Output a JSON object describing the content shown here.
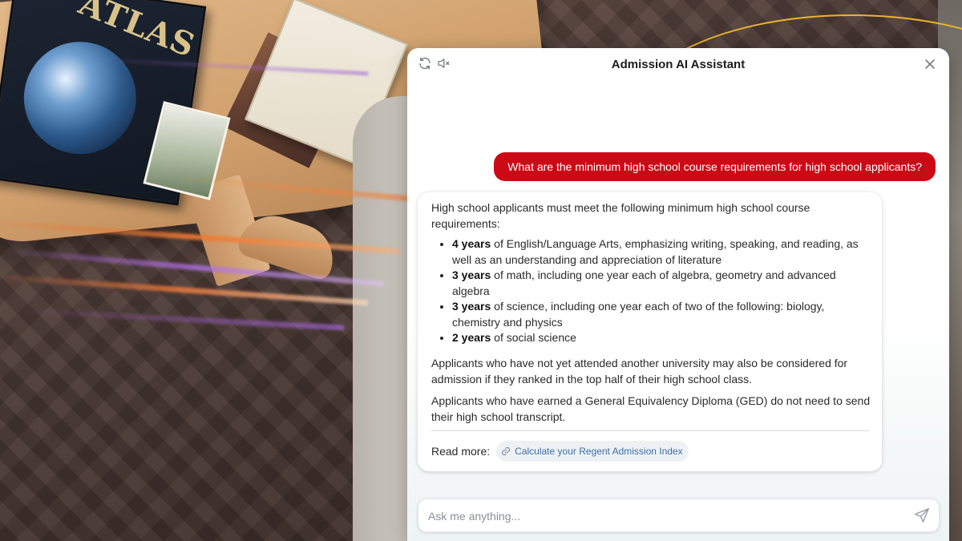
{
  "panel": {
    "title": "Admission AI Assistant",
    "icons": {
      "refresh": "refresh-icon",
      "mute": "speaker-mute-icon",
      "close": "close-icon",
      "send": "send-icon",
      "link": "link-icon"
    }
  },
  "conversation": {
    "user_message": "What are the minimum high school course requirements for high school applicants?",
    "bot": {
      "intro": "High school applicants must meet the following minimum high school course requirements:",
      "requirements": [
        {
          "years": "4 years",
          "text": " of English/Language Arts, emphasizing writing, speaking, and reading, as well as an understanding and appreciation of literature"
        },
        {
          "years": "3 years",
          "text": " of math, including one year each of algebra, geometry and advanced algebra"
        },
        {
          "years": "3 years",
          "text": " of science, including one year each of two of the following: biology, chemistry and physics"
        },
        {
          "years": "2 years",
          "text": " of social science"
        }
      ],
      "paragraph_1": "Applicants who have not yet attended another university may also be considered for admission if they ranked in the top half of their high school class.",
      "paragraph_2": "Applicants who have earned a General Equivalency Diploma (GED) do not need to send their high school transcript.",
      "read_more_label": "Read more:",
      "read_more_link": "Calculate your Regent Admission Index"
    }
  },
  "input": {
    "placeholder": "Ask me anything..."
  },
  "background": {
    "atlas_title": "ATLAS"
  },
  "colors": {
    "accent_red": "#cc0a16",
    "link_blue": "#3d6fa8",
    "arc_gold": "#e8b42e"
  }
}
